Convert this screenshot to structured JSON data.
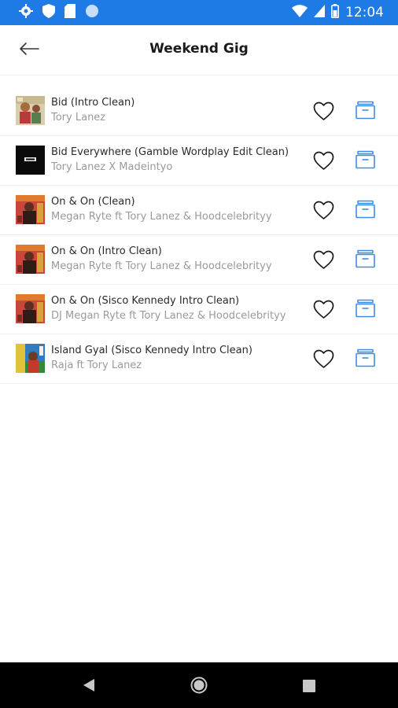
{
  "status_bar": {
    "time": "12:04",
    "icons": [
      "gear-icon",
      "shield-icon",
      "sd-card-icon",
      "circle-icon",
      "wifi-icon",
      "signal-icon",
      "battery-icon"
    ]
  },
  "header": {
    "title": "Weekend Gig",
    "back_icon": "arrow-left-icon"
  },
  "tracks": [
    {
      "title": "Bid  (Intro Clean)",
      "artist": "Tory Lanez"
    },
    {
      "title": "Bid Everywhere  (Gamble Wordplay Edit Clean)",
      "artist": "Tory Lanez X Madeintyo"
    },
    {
      "title": "On & On  (Clean)",
      "artist": "Megan Ryte ft Tory Lanez & Hoodcelebrityy"
    },
    {
      "title": "On & On  (Intro Clean)",
      "artist": "Megan Ryte ft Tory Lanez & Hoodcelebrityy"
    },
    {
      "title": "On & On  (Sisco Kennedy Intro Clean)",
      "artist": "DJ Megan Ryte ft Tory Lanez & Hoodcelebrityy"
    },
    {
      "title": "Island Gyal  (Sisco Kennedy Intro Clean)",
      "artist": "Raja ft Tory Lanez"
    }
  ],
  "colors": {
    "accent": "#1e7be6",
    "crate_icon": "#3d8de8"
  }
}
